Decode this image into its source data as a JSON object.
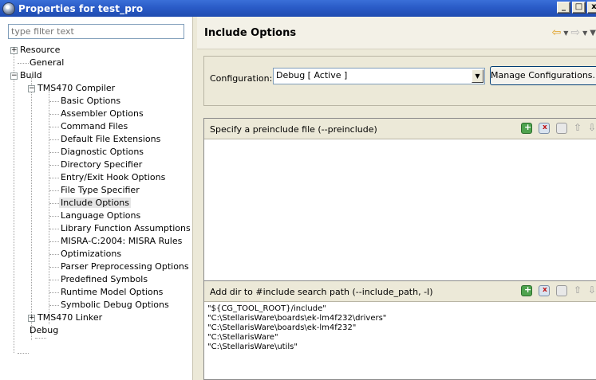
{
  "window": {
    "title": "Properties for test_pro",
    "buttons": [
      "_",
      "□",
      "x"
    ]
  },
  "filter": {
    "placeholder": "type filter text"
  },
  "tree": {
    "nodes": [
      {
        "label": "Resource"
      },
      {
        "label": "General"
      },
      {
        "label": "Build"
      },
      {
        "label": "TMS470 Compiler"
      },
      {
        "label": "Basic Options"
      },
      {
        "label": "Assembler Options"
      },
      {
        "label": "Command Files"
      },
      {
        "label": "Default File Extensions"
      },
      {
        "label": "Diagnostic Options"
      },
      {
        "label": "Directory Specifier"
      },
      {
        "label": "Entry/Exit Hook Options"
      },
      {
        "label": "File Type Specifier"
      },
      {
        "label": "Include Options",
        "selected": true
      },
      {
        "label": "Language Options"
      },
      {
        "label": "Library Function Assumptions"
      },
      {
        "label": "MISRA-C:2004: MISRA Rules"
      },
      {
        "label": "Optimizations"
      },
      {
        "label": "Parser Preprocessing Options"
      },
      {
        "label": "Predefined Symbols"
      },
      {
        "label": "Runtime Model Options"
      },
      {
        "label": "Symbolic Debug Options"
      },
      {
        "label": "TMS470 Linker"
      },
      {
        "label": "Debug"
      }
    ]
  },
  "page": {
    "title": "Include Options"
  },
  "config": {
    "label": "Configuration:",
    "selected": "Debug  [ Active ]",
    "manage_label": "Manage Configurations..."
  },
  "preinclude": {
    "title": "Specify a preinclude file (--preinclude)",
    "items": []
  },
  "include_path": {
    "title": "Add dir to #include search path (--include_path, -I)",
    "items": [
      "\"${CG_TOOL_ROOT}/include\"",
      "\"C:\\StellarisWare\\boards\\ek-lm4f232\\drivers\"",
      "\"C:\\StellarisWare\\boards\\ek-lm4f232\"",
      "\"C:\\StellarisWare\"",
      "\"C:\\StellarisWare\\utils\""
    ]
  },
  "colors": {
    "titlebar": "#2a5bc7",
    "panel_bg": "#ece9d8",
    "selection": "#e6e6e6"
  }
}
